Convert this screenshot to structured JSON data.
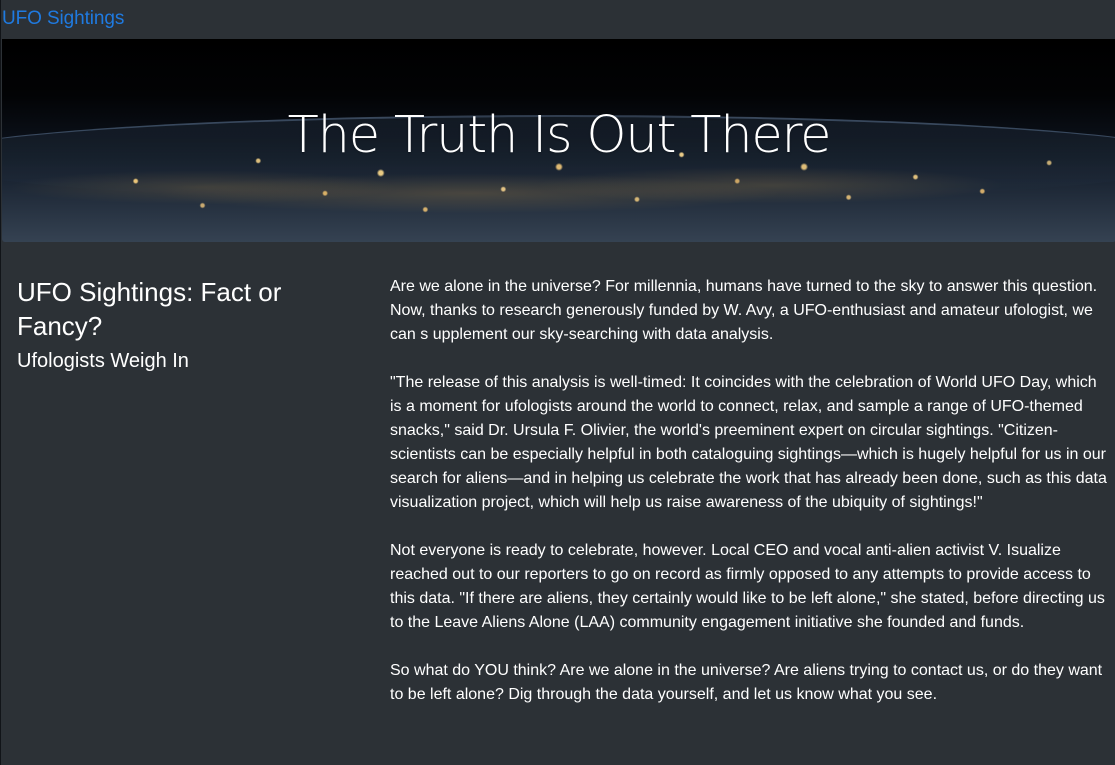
{
  "navbar": {
    "brand": "UFO Sightings"
  },
  "hero": {
    "title": "The Truth Is Out There"
  },
  "sidebar": {
    "heading": "UFO Sightings: Fact or Fancy?",
    "subheading": "Ufologists Weigh In"
  },
  "article": {
    "paragraphs": [
      "Are we alone in the universe? For millennia, humans have turned to the sky to answer this question. Now, thanks to research generously funded by W. Avy, a UFO-enthusiast and amateur ufologist, we can s upplement our sky-searching with data analysis.",
      "\"The release of this analysis is well-timed: It coincides with the celebration of World UFO Day, which is a moment for ufologists around the world to connect, relax, and sample a range of UFO-themed snacks,\" said Dr. Ursula F. Olivier, the world's preeminent expert on circular sightings. \"Citizen-scientists can be especially helpful in both cataloguing sightings—which is hugely helpful for us in our search for aliens—and in helping us celebrate the work that has already been done, such as this data visualization project, which will help us raise awareness of the ubiquity of sightings!\"",
      "Not everyone is ready to celebrate, however. Local CEO and vocal anti-alien activist V. Isualize reached out to our reporters to go on record as firmly opposed to any attempts to provide access to this data. \"If there are aliens, they certainly would like to be left alone,\" she stated, before directing us to the Leave Aliens Alone (LAA) community engagement initiative she founded and funds.",
      "So what do YOU think? Are we alone in the universe? Are aliens trying to contact us, or do they want to be left alone? Dig through the data yourself, and let us know what you see."
    ]
  }
}
